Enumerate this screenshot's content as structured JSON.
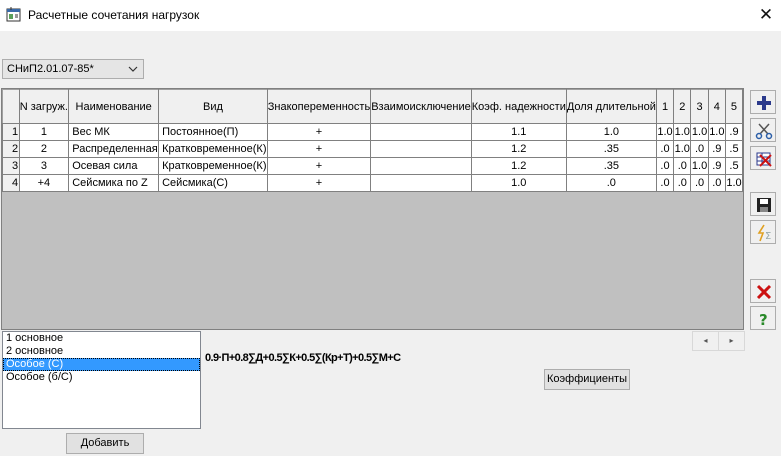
{
  "window": {
    "title": "Расчетные сочетания нагрузок",
    "close_glyph": "✕"
  },
  "norm_select": {
    "value": "СНиП2.01.07-85*"
  },
  "grid": {
    "columns": [
      "N загруж.",
      "Наименование",
      "Вид",
      "Знакопеременность",
      "Взаимоисключение",
      "Коэф. надежности",
      "Доля длительной",
      "1",
      "2",
      "3",
      "4",
      "5"
    ],
    "rows": [
      {
        "num": "1",
        "cells": [
          "1",
          "Вес МК",
          "Постоянное(П)",
          "+",
          "",
          "1.1",
          "1.0",
          "1.0",
          "1.0",
          "1.0",
          "1.0",
          ".9"
        ]
      },
      {
        "num": "2",
        "cells": [
          "2",
          "Распределенная",
          "Кратковременное(К)",
          "+",
          "",
          "1.2",
          ".35",
          ".0",
          "1.0",
          ".0",
          ".9",
          ".5"
        ]
      },
      {
        "num": "3",
        "cells": [
          "3",
          "Осевая сила",
          "Кратковременное(К)",
          "+",
          "",
          "1.2",
          ".35",
          ".0",
          ".0",
          "1.0",
          ".9",
          ".5"
        ]
      },
      {
        "num": "4",
        "cells": [
          "+4",
          "Сейсмика по Z",
          "Сейсмика(С)",
          "+",
          "",
          "1.0",
          ".0",
          ".0",
          ".0",
          ".0",
          ".0",
          "1.0"
        ]
      }
    ]
  },
  "toolbar": {
    "icons": [
      "add-icon",
      "cut-icon",
      "delete-table-icon",
      "save-icon",
      "calculate-icon",
      "close-icon",
      "help-icon"
    ]
  },
  "combos": {
    "items": [
      "1 основное",
      "2 основное",
      "Особое (С)",
      "Особое (б/С)"
    ],
    "selected_index": 2
  },
  "formula": "0.9·П+0.8∑Д+0.5∑К+0.5∑(Кр+Т)+0.5∑М+С",
  "buttons": {
    "add": "Добавить",
    "coefficients": "Коэффициенты",
    "scroll_left": "◂",
    "scroll_right": "▸"
  },
  "colors": {
    "selection": "#3399ff",
    "grid_background": "#c0c0c0",
    "add_icon": "#2b3a8c",
    "delete_icon": "#cc1111",
    "help_icon": "#2a8a2a"
  }
}
